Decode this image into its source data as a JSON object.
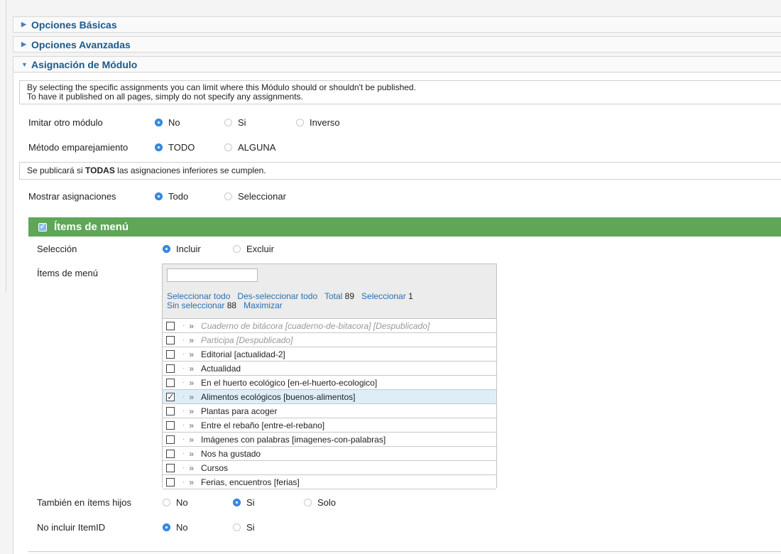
{
  "panels": {
    "basic": "Opciones Básicas",
    "advanced": "Opciones Avanzadas",
    "assignment": "Asignación de Módulo"
  },
  "intro_note": {
    "line1": "By selecting the specific assignments you can limit where this Módulo should or shouldn't be published.",
    "line2": "To have it published on all pages, simply do not specify any assignments."
  },
  "mirror": {
    "label": "Imitar otro módulo",
    "options": [
      "No",
      "Si",
      "Inverso"
    ],
    "selected": "No"
  },
  "match_method": {
    "label": "Método emparejamiento",
    "options": [
      "TODO",
      "ALGUNA"
    ],
    "selected": "TODO"
  },
  "publish_note": {
    "prefix": "Se publicará si ",
    "bold": "TODAS",
    "suffix": " las asignaciones inferiores se cumplen."
  },
  "show_assignments": {
    "label": "Mostrar asignaciones",
    "options": [
      "Todo",
      "Seleccionar"
    ],
    "selected": "Todo"
  },
  "menu_section": {
    "title": "Ítems de menú",
    "selection": {
      "label": "Selección",
      "options": [
        "Incluir",
        "Excluir"
      ],
      "selected": "Incluir"
    },
    "items_label": "Ítems de menú",
    "search_value": "",
    "links": {
      "select_all": "Seleccionar todo",
      "deselect_all": "Des-seleccionar todo",
      "total_label": "Total",
      "total_value": "89",
      "select_label": "Seleccionar",
      "select_value": "1",
      "unselected_label": "Sin seleccionar",
      "unselected_value": "88",
      "maximize": "Maximizar"
    },
    "items": [
      {
        "text": "Cuaderno de bitácora [cuaderno-de-bitacora] [Despublicado]",
        "checked": false,
        "unpublished": true
      },
      {
        "text": "Participa [Despublicado]",
        "checked": false,
        "unpublished": true
      },
      {
        "text": "Editorial [actualidad-2]",
        "checked": false,
        "unpublished": false
      },
      {
        "text": "Actualidad",
        "checked": false,
        "unpublished": false
      },
      {
        "text": "En el huerto ecológico [en-el-huerto-ecologico]",
        "checked": false,
        "unpublished": false
      },
      {
        "text": "Alimentos ecológicos [buenos-alimentos]",
        "checked": true,
        "unpublished": false
      },
      {
        "text": "Plantas para acoger",
        "checked": false,
        "unpublished": false
      },
      {
        "text": "Entre el rebaño [entre-el-rebano]",
        "checked": false,
        "unpublished": false
      },
      {
        "text": "Imágenes con palabras [imagenes-con-palabras]",
        "checked": false,
        "unpublished": false
      },
      {
        "text": "Nos ha gustado",
        "checked": false,
        "unpublished": false
      },
      {
        "text": "Cursos",
        "checked": false,
        "unpublished": false
      },
      {
        "text": "Ferias, encuentros [ferias]",
        "checked": false,
        "unpublished": false
      }
    ],
    "item_dots": "·",
    "item_arrow": "»",
    "also_children": {
      "label": "También en ítems hijos",
      "options": [
        "No",
        "Si",
        "Solo"
      ],
      "selected": "Si"
    },
    "no_itemid": {
      "label": "No incluir ItemID",
      "options": [
        "No",
        "Si"
      ],
      "selected": "No"
    }
  },
  "colors": {
    "accent_green": "#5fa659",
    "link_blue": "#2a6fb0",
    "radio_blue": "#3a8ee6"
  }
}
